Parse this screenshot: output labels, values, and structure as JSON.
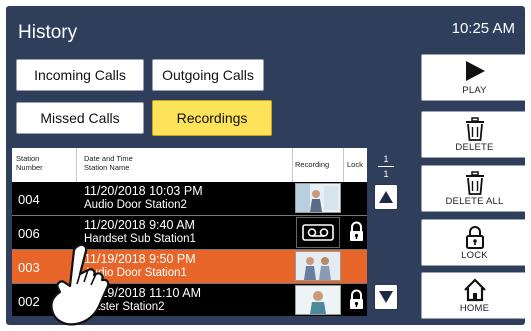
{
  "header": {
    "title": "History",
    "time": "10:25 AM"
  },
  "tabs": {
    "incoming": "Incoming Calls",
    "outgoing": "Outgoing Calls",
    "missed": "Missed Calls",
    "recordings": "Recordings",
    "active": "recordings"
  },
  "list": {
    "columns": {
      "station_number_line1": "Station",
      "station_number_line2": "Number",
      "date_time_line1": "Date and Time",
      "date_time_line2": "Station Name",
      "recording": "Recording",
      "lock": "Lock"
    },
    "rows": [
      {
        "number": "004",
        "datetime": "11/20/2018 10:03 PM",
        "station": "Audio Door Station2",
        "recording": "image",
        "locked": false,
        "selected": false
      },
      {
        "number": "006",
        "datetime": "11/20/2018  9:40 AM",
        "station": "Handset Sub Station1",
        "recording": "audio",
        "locked": true,
        "selected": false
      },
      {
        "number": "003",
        "datetime": "11/19/2018  9:50 PM",
        "station": "Audio Door Station1",
        "recording": "image",
        "locked": false,
        "selected": true
      },
      {
        "number": "002",
        "datetime": "11/19/2018 11:10 AM",
        "station": "Master Station2",
        "recording": "image",
        "locked": true,
        "selected": false
      }
    ]
  },
  "pagination": {
    "current": "1",
    "total": "1"
  },
  "side_buttons": {
    "play": "PLAY",
    "delete": "DELETE",
    "delete_all": "DELETE ALL",
    "lock": "LOCK",
    "home": "HOME"
  },
  "colors": {
    "background": "#2f3e5b",
    "selected_row": "#e8652a",
    "active_tab": "#fde35a"
  },
  "icons": [
    "play-icon",
    "trash-icon",
    "trash-all-icon",
    "lock-icon",
    "home-icon",
    "scroll-up-icon",
    "scroll-down-icon",
    "tape-icon",
    "touch-hand-icon"
  ]
}
